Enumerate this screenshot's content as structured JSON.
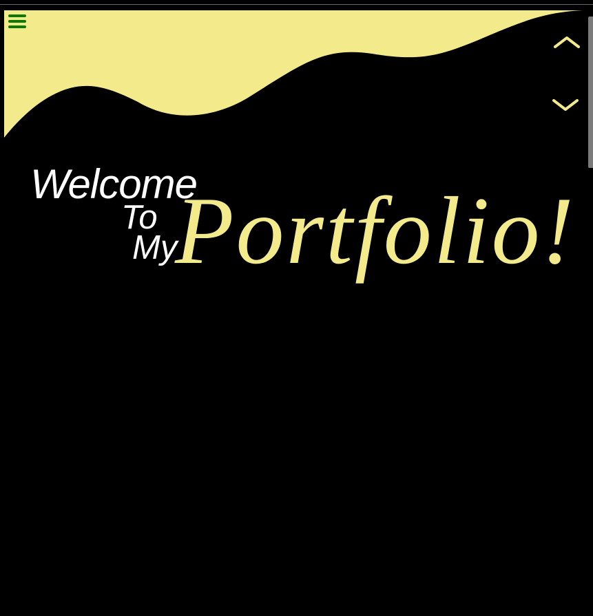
{
  "colors": {
    "background": "#000000",
    "wave_fill": "#f3ea8c",
    "menu_icon": "#0b7a0b",
    "arrow_icons": "#f3ea8c",
    "heading_white": "#ffffff",
    "heading_accent": "#f3ea8c",
    "scrollbar_thumb": "#7b7b7b"
  },
  "nav": {
    "menu_icon": "hamburger-menu-icon",
    "scroll_up_icon": "chevron-up-icon",
    "scroll_down_icon": "chevron-down-icon"
  },
  "hero": {
    "line_welcome": "Welcome",
    "line_to": "To",
    "line_my": "My",
    "line_portfolio": "Portfolio!"
  }
}
